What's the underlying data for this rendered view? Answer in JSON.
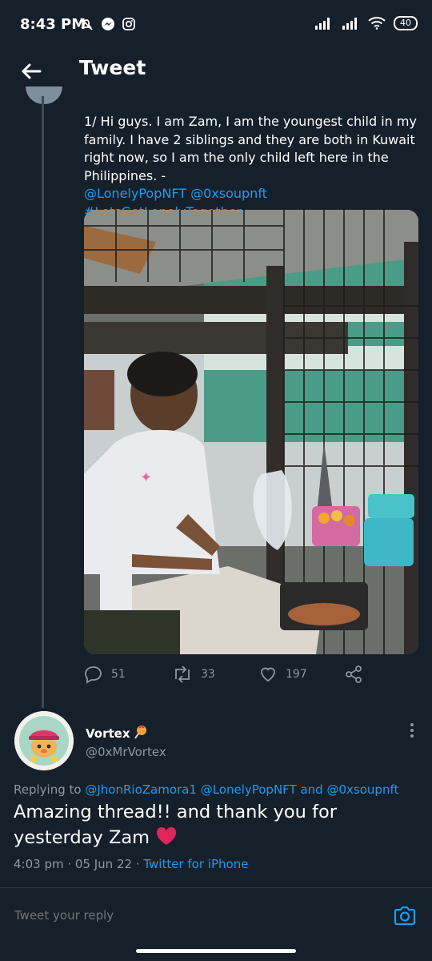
{
  "status_bar": {
    "time": "8:43 PM",
    "battery": "40",
    "left_icons": [
      "mute-icon",
      "messenger-icon",
      "instagram-icon"
    ],
    "right_icons": [
      "signal-icon",
      "signal-icon",
      "wifi-icon",
      "battery-icon"
    ]
  },
  "header": {
    "title": "Tweet"
  },
  "tweet": {
    "line1": "1/ Hi guys. I am Zam, I am the youngest child in my family. I have 2 siblings and they are both in Kuwait right now, so I am the only child left here in the Philippines. -",
    "mention1": "@LonelyPopNFT",
    "mention2": "@0xsoupnft",
    "hashtag": "#LetsGetLonelyTogether",
    "replies": "51",
    "retweets": "33",
    "likes": "197"
  },
  "reply": {
    "name": "Vortex",
    "handle": "@0xMrVortex",
    "replying_prefix": "Replying to",
    "replying_to_1": "@JhonRioZamora1",
    "replying_to_2": "@LonelyPopNFT",
    "replying_and": "and",
    "replying_to_3": "@0xsoupnft",
    "text": "Amazing thread!! and thank you for yesterday Zam",
    "timestamp": "4:03 pm · 05 Jun 22 ·",
    "source": "Twitter for iPhone"
  },
  "compose": {
    "placeholder": "Tweet your reply"
  },
  "colors": {
    "accent": "#1d9bf0",
    "background": "#15202b",
    "muted": "#8b98a5",
    "heart": "#e0245e"
  }
}
